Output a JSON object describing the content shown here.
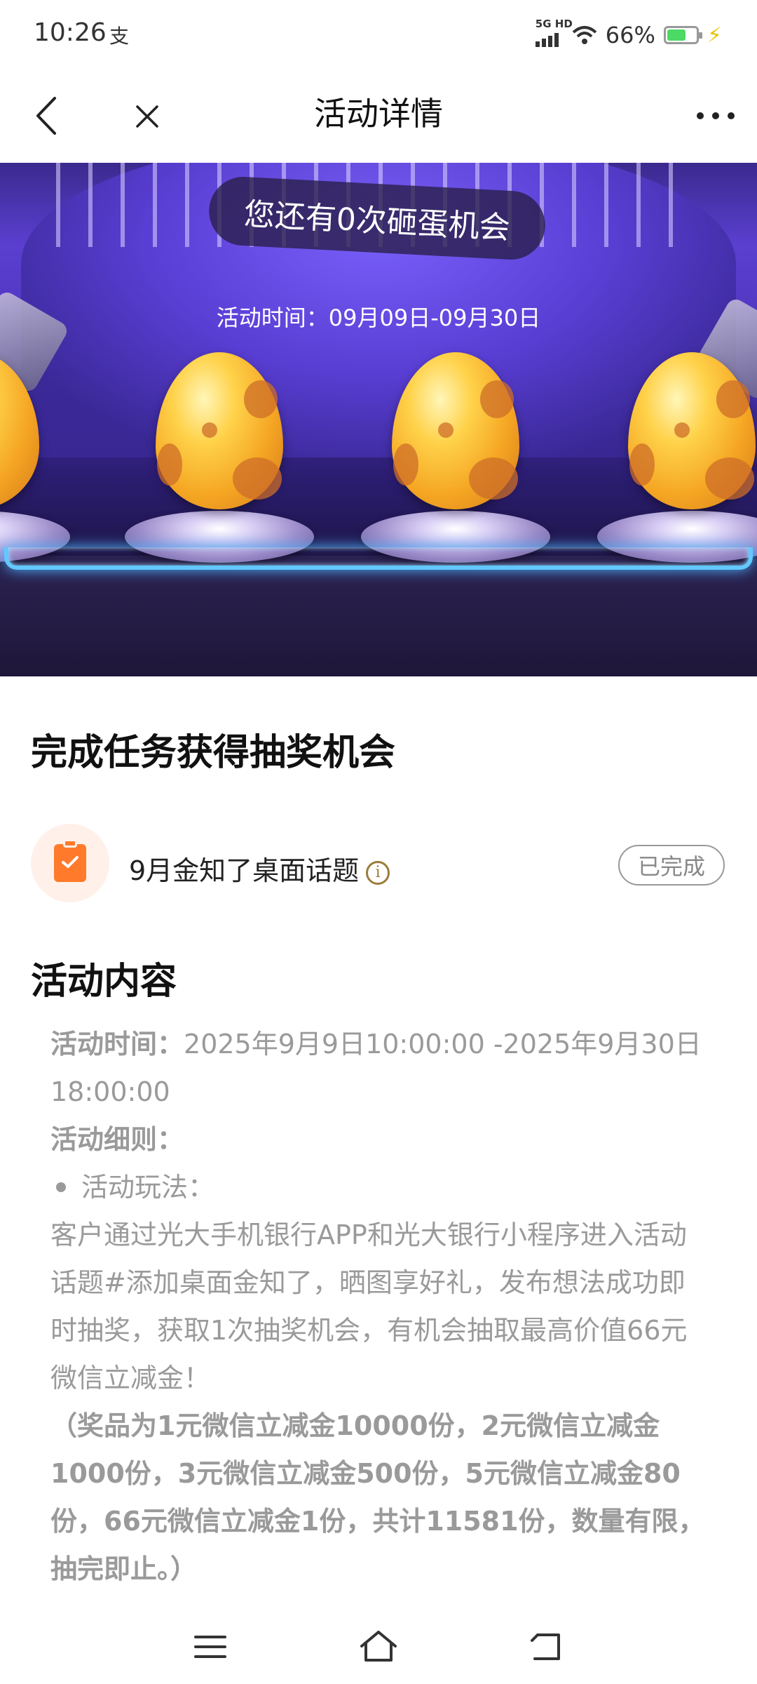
{
  "status_bar": {
    "time": "10:26",
    "left_icon": "支",
    "network_label": "5G HD",
    "battery_text": "66%",
    "battery_level": 0.66,
    "battery_color": "#4cd964"
  },
  "header": {
    "title": "活动详情"
  },
  "banner": {
    "chance_text": "您还有0次砸蛋机会",
    "activity_time": "活动时间：09月09日-09月30日"
  },
  "task_section": {
    "title": "完成任务获得抽奖机会",
    "task_label": "9月金知了桌面话题",
    "task_status": "已完成",
    "accent_color": "#ff7a2b"
  },
  "content_section": {
    "title": "活动内容",
    "time_label": "活动时间：",
    "time_value": "2025年9月9日10:00:00 -2025年9月30日 18:00:00",
    "rules_label": "活动细则：",
    "bullet_label": "活动玩法：",
    "rules_text": "客户通过光大手机银行APP和光大银行小程序进入活动话题#添加桌面金知了，晒图享好礼，发布想法成功即时抽奖，获取1次抽奖机会，有机会抽取最高价值66元微信立减金！",
    "prize_text": "（奖品为1元微信立减金10000份，2元微信立减金1000份，3元微信立减金500份，5元微信立减金80份，66元微信立减金1份，共计11581份，数量有限，抽完即止。）"
  },
  "icons": {
    "back": "chevron-left-icon",
    "close": "close-icon",
    "more": "more-icon",
    "task": "clipboard-check-icon",
    "info": "info-icon",
    "menu": "menu-icon",
    "home": "home-icon",
    "return": "return-icon"
  }
}
